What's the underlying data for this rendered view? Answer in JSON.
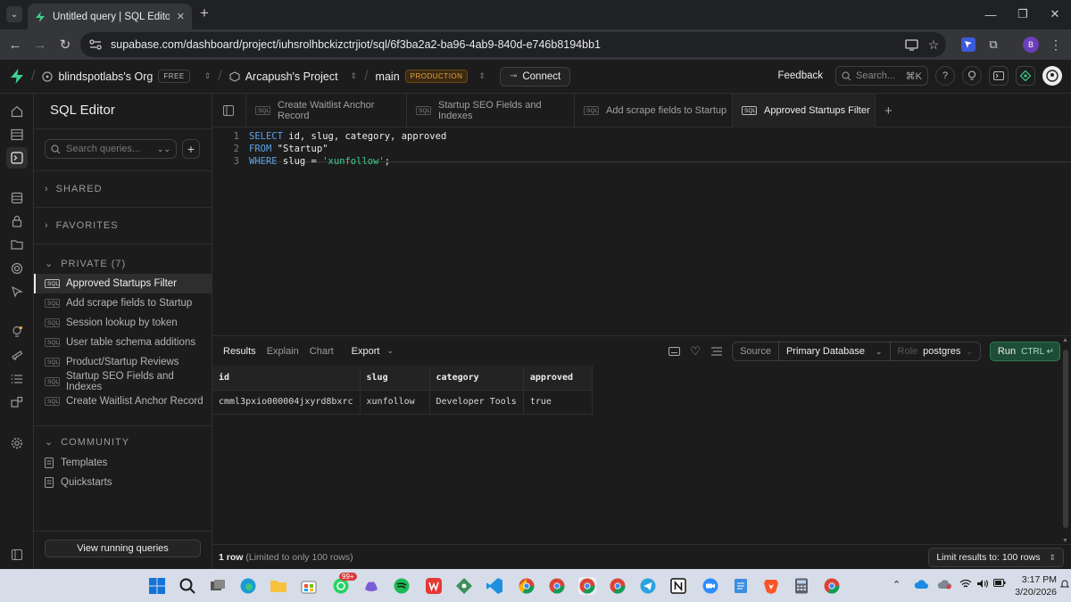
{
  "browser": {
    "tab_title": "Untitled query | SQL Editor | Arc",
    "url": "supabase.com/dashboard/project/iuhsrolhbckizctrjiot/sql/6f3ba2a2-ba96-4ab9-840d-e746b8194bb1",
    "profile_initial": "B"
  },
  "topbar": {
    "org": "blindspotlabs's Org",
    "org_badge": "FREE",
    "project": "Arcapush's Project",
    "branch": "main",
    "branch_badge": "PRODUCTION",
    "connect_label": "Connect",
    "feedback_label": "Feedback",
    "search_placeholder": "Search...",
    "search_shortcut": "⌘K"
  },
  "sidebar": {
    "title": "SQL Editor",
    "search_placeholder": "Search queries...",
    "shared_label": "SHARED",
    "favorites_label": "FAVORITES",
    "private_label": "PRIVATE (7)",
    "sql_tag": "SQL",
    "queries": [
      {
        "label": "Approved Startups Filter",
        "active": true
      },
      {
        "label": "Add scrape fields to Startup",
        "active": false
      },
      {
        "label": "Session lookup by token",
        "active": false
      },
      {
        "label": "User table schema additions",
        "active": false
      },
      {
        "label": "Product/Startup Reviews",
        "active": false
      },
      {
        "label": "Startup SEO Fields and Indexes",
        "active": false
      },
      {
        "label": "Create Waitlist Anchor Record",
        "active": false
      }
    ],
    "community_label": "COMMUNITY",
    "community_items": [
      "Templates",
      "Quickstarts"
    ],
    "running_queries_label": "View running queries"
  },
  "editor_tabs": [
    {
      "label": "Create Waitlist Anchor Record",
      "active": false
    },
    {
      "label": "Startup SEO Fields and Indexes",
      "active": false
    },
    {
      "label": "Add scrape fields to Startup",
      "active": false
    },
    {
      "label": "Approved Startups Filter",
      "active": true
    }
  ],
  "editor": {
    "lines": [
      {
        "n": "1",
        "kw": "SELECT",
        "rest": " id, slug, category, approved",
        "str": "",
        "tail": ""
      },
      {
        "n": "2",
        "kw": "FROM",
        "rest": " \"Startup\"",
        "str": "",
        "tail": ""
      },
      {
        "n": "3",
        "kw": "WHERE",
        "rest": " slug = ",
        "str": "'xunfollow'",
        "tail": ";"
      }
    ]
  },
  "results": {
    "tabs": [
      "Results",
      "Explain",
      "Chart"
    ],
    "export_label": "Export",
    "source_label": "Source",
    "source_value": "Primary Database",
    "role_label": "Role",
    "role_value": "postgres",
    "run_label": "Run",
    "run_shortcut": "CTRL ↵",
    "columns": [
      "id",
      "slug",
      "category",
      "approved"
    ],
    "rows": [
      [
        "cmml3pxio000004jxyrd8bxrc",
        "xunfollow",
        "Developer Tools",
        "true"
      ]
    ],
    "row_count": "1 row",
    "row_limit_note": "(Limited to only 100 rows)",
    "limit_label": "Limit results to: 100 rows"
  },
  "taskbar": {
    "whatsapp_badge": "99+",
    "time": "3:17 PM",
    "date": "3/20/2026"
  },
  "colors": {
    "accent_green": "#3ecf8e",
    "keyword_blue": "#5aa2e6",
    "production_orange": "#e8a33d"
  }
}
